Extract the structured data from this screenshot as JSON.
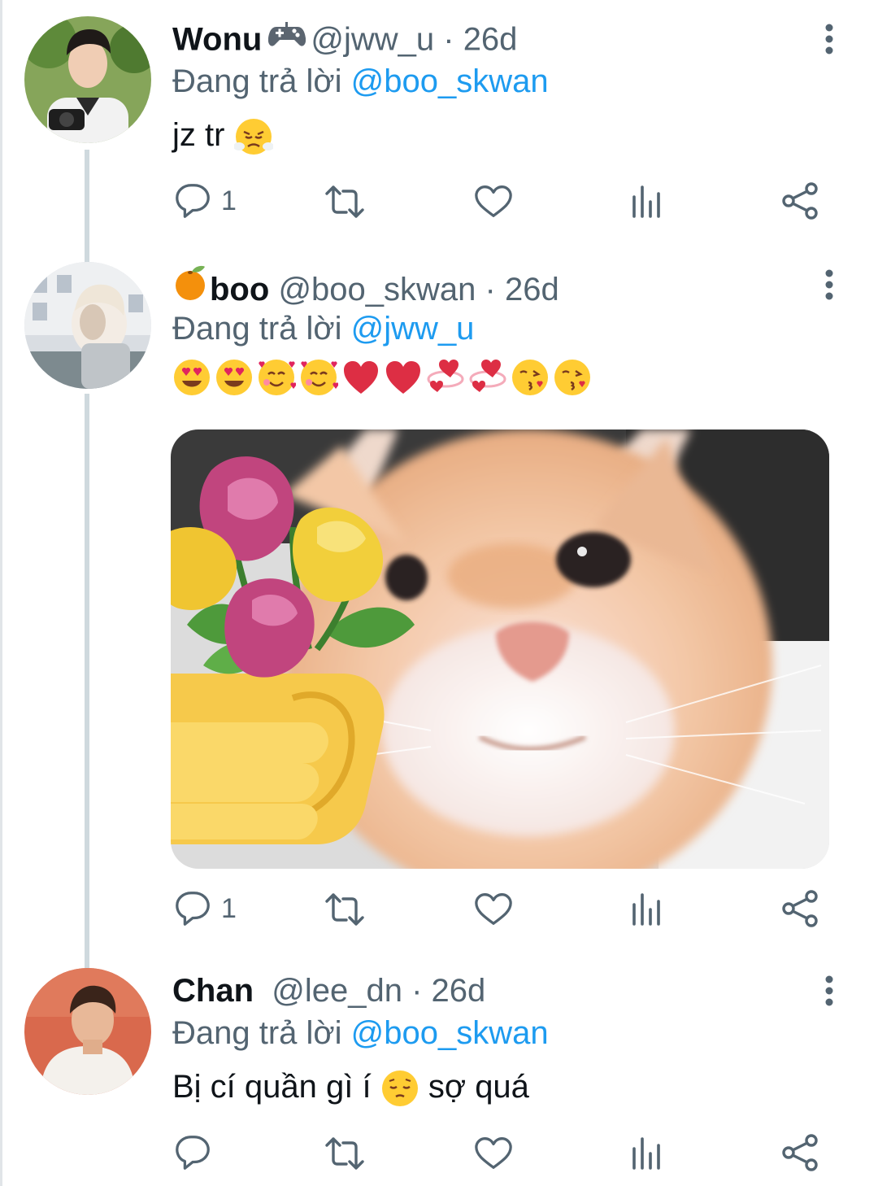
{
  "reply_prefix": "Đang trả lời",
  "tweets": [
    {
      "name": "Wonu",
      "name_icon": "game-controller-icon",
      "handle": "@jww_u",
      "separator": "·",
      "time": "26d",
      "reply_to": "@boo_skwan",
      "text": "jz tr",
      "text_emoji": "face-with-steam-from-nose",
      "reply_count": "1"
    },
    {
      "name": "boo",
      "name_icon": "tangerine-icon",
      "handle": "@boo_skwan",
      "separator": "·",
      "time": "26d",
      "reply_to": "@jww_u",
      "emojis": [
        "heart-eyes",
        "heart-eyes",
        "smiling-face-with-hearts",
        "smiling-face-with-hearts",
        "red-heart",
        "red-heart",
        "revolving-hearts",
        "revolving-hearts",
        "face-blowing-kiss",
        "face-blowing-kiss"
      ],
      "media": "cat-with-flower-bouquet-photo",
      "reply_count": "1"
    },
    {
      "name": "Chan",
      "handle": "@lee_dn",
      "separator": "·",
      "time": "26d",
      "reply_to": "@boo_skwan",
      "text_before": "Bị cí quần gì í",
      "text_emoji": "pensive-face",
      "text_after": "sợ quá",
      "reply_count": ""
    }
  ],
  "colors": {
    "text": "#0f1419",
    "secondary": "#536471",
    "link": "#1d9bf0",
    "thread_line": "#cfd9de"
  }
}
